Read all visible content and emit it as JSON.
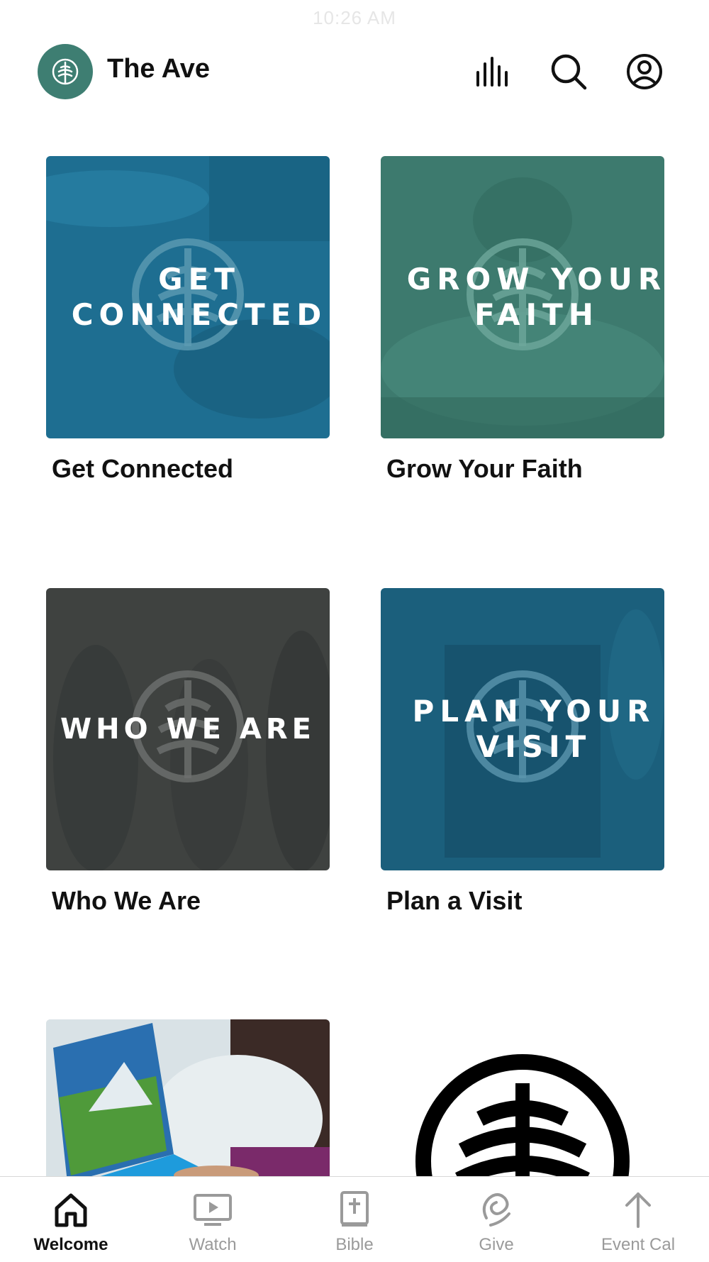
{
  "status_bar": {
    "time": "10:26 AM"
  },
  "header": {
    "title": "The Ave",
    "brand_color": "#3e7e72"
  },
  "cards": [
    {
      "overlay_text": "GET CONNECTED",
      "label": "Get Connected",
      "tint": "#1e6e91"
    },
    {
      "overlay_text": "GROW YOUR FAITH",
      "label": "Grow Your Faith",
      "tint": "#3d7a6e"
    },
    {
      "overlay_text": "WHO WE ARE",
      "label": "Who We Are",
      "tint": "#3f4240"
    },
    {
      "overlay_text": "PLAN YOUR VISIT",
      "label": "Plan a Visit",
      "tint": "#1b5f7c"
    }
  ],
  "tabs": [
    {
      "label": "Welcome",
      "icon": "home-icon",
      "active": true
    },
    {
      "label": "Watch",
      "icon": "tv-play-icon",
      "active": false
    },
    {
      "label": "Bible",
      "icon": "bible-icon",
      "active": false
    },
    {
      "label": "Give",
      "icon": "give-icon",
      "active": false
    },
    {
      "label": "Event Cal",
      "icon": "arrow-up-icon",
      "active": false
    }
  ]
}
